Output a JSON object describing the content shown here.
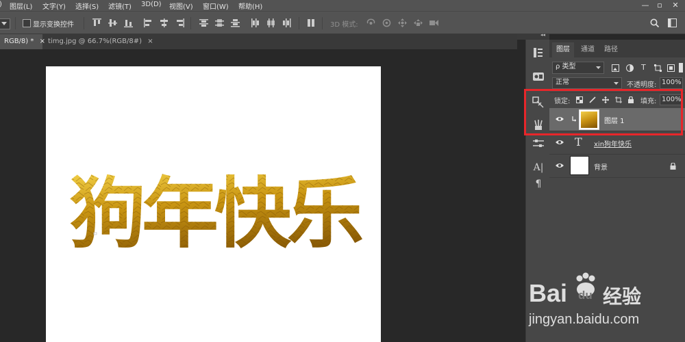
{
  "menubar": {
    "items": [
      "图层(L)",
      "文字(Y)",
      "选择(S)",
      "滤镜(T)",
      "3D(D)",
      "视图(V)",
      "窗口(W)",
      "帮助(H)"
    ],
    "window_controls": [
      "—",
      "▫",
      "✕"
    ]
  },
  "options_bar": {
    "show_transform_label": "显示变换控件",
    "mode_3d_label": "3D 模式:",
    "show_transform_checked": false
  },
  "document_tabs": [
    {
      "label": "RGB/8) *",
      "close": "×",
      "active": true
    },
    {
      "label": "timg.jpg @ 66.7%(RGB/8#)",
      "close": "×",
      "active": false
    }
  ],
  "canvas": {
    "text": "狗年快乐",
    "text_color_gradient": [
      "#f5d44a",
      "#c99512",
      "#8a5b05"
    ]
  },
  "layers_panel": {
    "collapse_glyph": "◂◂",
    "tabs": [
      "图层",
      "通道",
      "路径"
    ],
    "active_tab": "图层",
    "filter": {
      "label": "类型",
      "search_glyph": "ρ"
    },
    "blend_mode": "正常",
    "opacity_label": "不透明度:",
    "opacity_value": "100%",
    "lock_label": "锁定:",
    "fill_label": "填充:",
    "fill_value": "100%",
    "layers": [
      {
        "name": "图层 1",
        "type": "image",
        "selected": true,
        "visible": true,
        "clipped": true
      },
      {
        "name": "xin狗年快乐",
        "type": "text",
        "selected": false,
        "visible": true,
        "thumb_glyph": "T"
      },
      {
        "name": "背景",
        "type": "background",
        "selected": false,
        "visible": true,
        "locked": true
      }
    ]
  },
  "watermark": {
    "brand": "Bai",
    "brand2": "du",
    "brand_cn": "经验",
    "url": "jingyan.baidu.com"
  },
  "colors": {
    "highlight_box": "#e8262a",
    "panel_bg": "#474747",
    "chrome_bg": "#535353",
    "workspace_bg": "#282828",
    "selected_row": "#6a6a6a"
  }
}
